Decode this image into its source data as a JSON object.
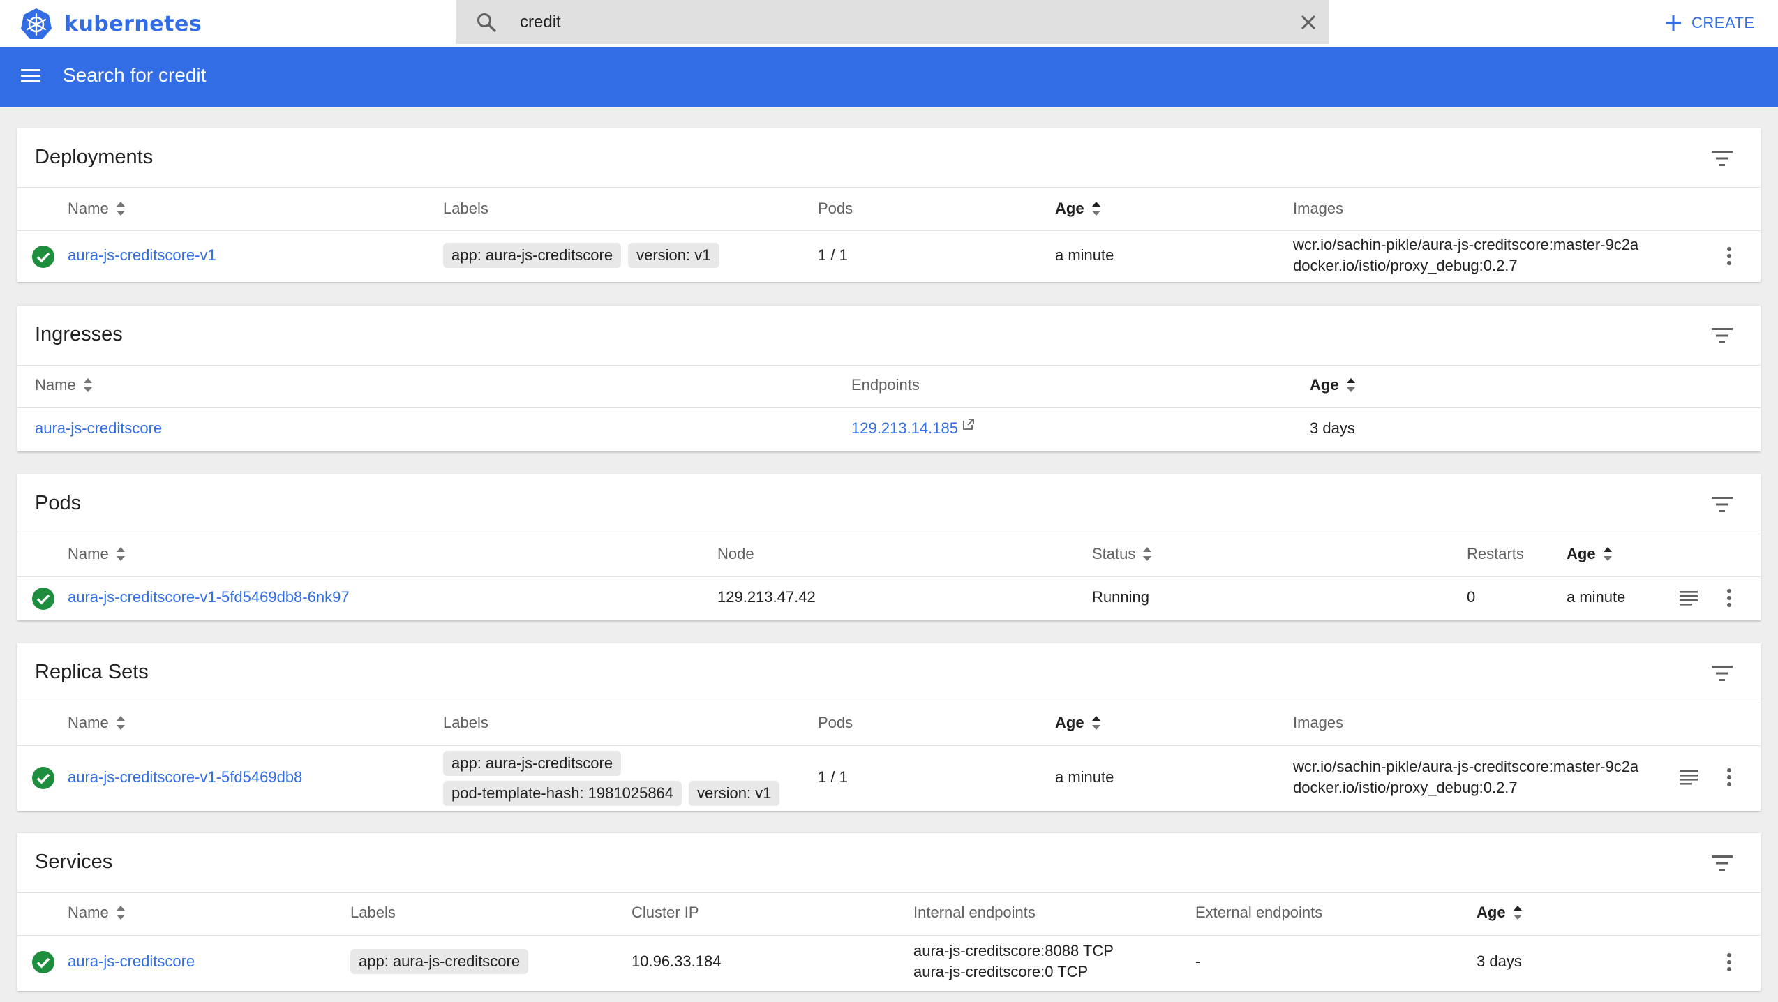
{
  "brand": {
    "name": "kubernetes"
  },
  "search": {
    "value": "credit",
    "placeholder": "Search"
  },
  "topbar": {
    "create_label": "CREATE"
  },
  "appbar": {
    "title": "Search for credit"
  },
  "colors": {
    "accent": "#326de6",
    "success": "#1e8e3e"
  },
  "deployments": {
    "title": "Deployments",
    "headers": {
      "name": "Name",
      "labels": "Labels",
      "pods": "Pods",
      "age": "Age",
      "images": "Images"
    },
    "rows": [
      {
        "name": "aura-js-creditscore-v1",
        "labels": [
          "app: aura-js-creditscore",
          "version: v1"
        ],
        "pods": "1 / 1",
        "age": "a minute",
        "images": [
          "wcr.io/sachin-pikle/aura-js-creditscore:master-9c2a",
          "docker.io/istio/proxy_debug:0.2.7"
        ]
      }
    ]
  },
  "ingresses": {
    "title": "Ingresses",
    "headers": {
      "name": "Name",
      "endpoints": "Endpoints",
      "age": "Age"
    },
    "rows": [
      {
        "name": "aura-js-creditscore",
        "endpoint": "129.213.14.185",
        "age": "3 days"
      }
    ]
  },
  "pods": {
    "title": "Pods",
    "headers": {
      "name": "Name",
      "node": "Node",
      "status": "Status",
      "restarts": "Restarts",
      "age": "Age"
    },
    "rows": [
      {
        "name": "aura-js-creditscore-v1-5fd5469db8-6nk97",
        "node": "129.213.47.42",
        "status": "Running",
        "restarts": "0",
        "age": "a minute"
      }
    ]
  },
  "replica_sets": {
    "title": "Replica Sets",
    "headers": {
      "name": "Name",
      "labels": "Labels",
      "pods": "Pods",
      "age": "Age",
      "images": "Images"
    },
    "rows": [
      {
        "name": "aura-js-creditscore-v1-5fd5469db8",
        "labels": [
          "app: aura-js-creditscore",
          "pod-template-hash: 1981025864",
          "version: v1"
        ],
        "pods": "1 / 1",
        "age": "a minute",
        "images": [
          "wcr.io/sachin-pikle/aura-js-creditscore:master-9c2a",
          "docker.io/istio/proxy_debug:0.2.7"
        ]
      }
    ]
  },
  "services": {
    "title": "Services",
    "headers": {
      "name": "Name",
      "labels": "Labels",
      "cluster_ip": "Cluster IP",
      "internal": "Internal endpoints",
      "external": "External endpoints",
      "age": "Age"
    },
    "rows": [
      {
        "name": "aura-js-creditscore",
        "labels": [
          "app: aura-js-creditscore"
        ],
        "cluster_ip": "10.96.33.184",
        "internal": [
          "aura-js-creditscore:8088 TCP",
          "aura-js-creditscore:0 TCP"
        ],
        "external": "-",
        "age": "3 days"
      }
    ]
  }
}
